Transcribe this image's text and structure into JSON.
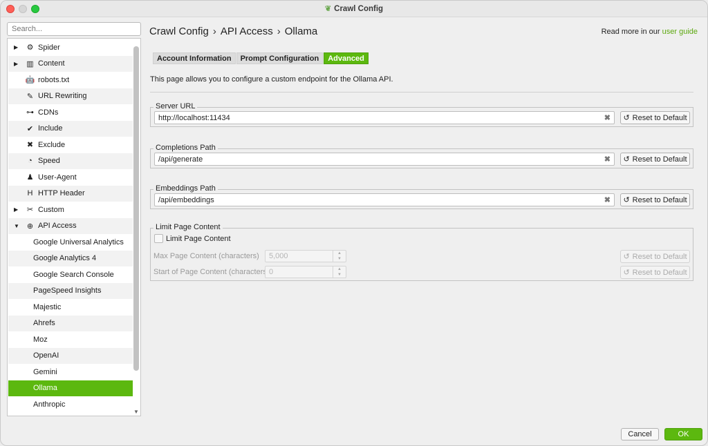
{
  "window": {
    "title": "Crawl Config"
  },
  "search": {
    "placeholder": "Search..."
  },
  "tree": [
    {
      "label": "Spider",
      "icon": "gear-icon",
      "glyph": "⚙",
      "arrow": "▶"
    },
    {
      "label": "Content",
      "icon": "table-icon",
      "glyph": "▥",
      "arrow": "▶"
    },
    {
      "label": "robots.txt",
      "icon": "robot-icon",
      "glyph": "🤖",
      "arrow": ""
    },
    {
      "label": "URL Rewriting",
      "icon": "edit-icon",
      "glyph": "✎",
      "arrow": ""
    },
    {
      "label": "CDNs",
      "icon": "network-icon",
      "glyph": "⊶",
      "arrow": ""
    },
    {
      "label": "Include",
      "icon": "check-circle-icon",
      "glyph": "✔",
      "arrow": ""
    },
    {
      "label": "Exclude",
      "icon": "x-circle-icon",
      "glyph": "✖",
      "arrow": ""
    },
    {
      "label": "Speed",
      "icon": "speedometer-icon",
      "glyph": "◔",
      "arrow": ""
    },
    {
      "label": "User-Agent",
      "icon": "user-secret-icon",
      "glyph": "♟",
      "arrow": ""
    },
    {
      "label": "HTTP Header",
      "icon": "header-icon",
      "glyph": "H",
      "arrow": ""
    },
    {
      "label": "Custom",
      "icon": "tools-icon",
      "glyph": "✂",
      "arrow": "▶"
    },
    {
      "label": "API Access",
      "icon": "globe-icon",
      "glyph": "⊕",
      "arrow": "▼"
    },
    {
      "label": "Google Universal Analytics",
      "child": true
    },
    {
      "label": "Google Analytics 4",
      "child": true
    },
    {
      "label": "Google Search Console",
      "child": true
    },
    {
      "label": "PageSpeed Insights",
      "child": true
    },
    {
      "label": "Majestic",
      "child": true
    },
    {
      "label": "Ahrefs",
      "child": true
    },
    {
      "label": "Moz",
      "child": true
    },
    {
      "label": "OpenAI",
      "child": true
    },
    {
      "label": "Gemini",
      "child": true
    },
    {
      "label": "Ollama",
      "child": true,
      "selected": true
    },
    {
      "label": "Anthropic",
      "child": true
    }
  ],
  "header": {
    "crumb1": "Crawl Config",
    "crumb2": "API Access",
    "crumb3": "Ollama",
    "sep": "›",
    "readmore_prefix": "Read more in our",
    "readmore_link": "user guide"
  },
  "tabs": [
    {
      "label": "Account Information"
    },
    {
      "label": "Prompt Configuration"
    },
    {
      "label": "Advanced",
      "active": true
    }
  ],
  "description": "This page allows you to configure a custom endpoint for the Ollama API.",
  "server_url": {
    "title": "Server URL",
    "value": "http://localhost:11434"
  },
  "completions_path": {
    "title": "Completions Path",
    "value": "/api/generate"
  },
  "embeddings_path": {
    "title": "Embeddings Path",
    "value": "/api/embeddings"
  },
  "reset_label": "Reset to Default",
  "clear_glyph": "✖",
  "limit": {
    "title": "Limit Page Content",
    "checkbox_label": "Limit Page Content",
    "max_label": "Max Page Content (characters)",
    "max_value": "5,000",
    "start_label": "Start of Page Content (characters)",
    "start_value": "0"
  },
  "footer": {
    "cancel": "Cancel",
    "ok": "OK"
  },
  "colors": {
    "accent": "#5cb80f"
  }
}
